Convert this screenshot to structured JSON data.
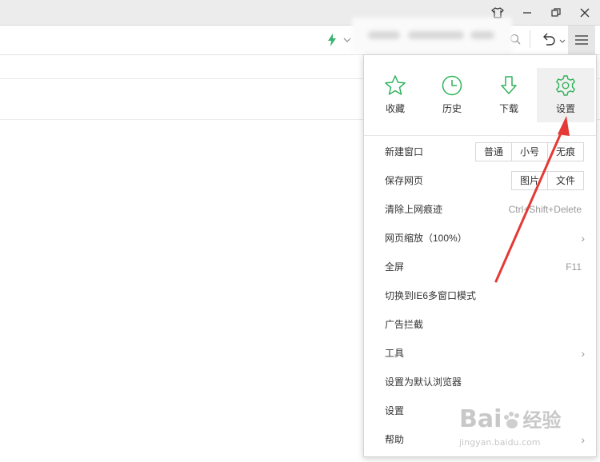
{
  "titlebar": {
    "icons": [
      "shirt-icon",
      "minimize-icon",
      "restore-icon",
      "close-icon"
    ]
  },
  "addressbar": {
    "icons": [
      "lightning-icon",
      "chevron-down-icon",
      "search-icon",
      "undo-icon",
      "menu-icon"
    ],
    "accent": "#3cb371"
  },
  "menu": {
    "quick": [
      {
        "icon": "star-icon",
        "label": "收藏"
      },
      {
        "icon": "clock-icon",
        "label": "历史"
      },
      {
        "icon": "download-icon",
        "label": "下载"
      },
      {
        "icon": "gear-icon",
        "label": "设置"
      }
    ],
    "items": [
      {
        "label": "新建窗口",
        "buttons": [
          "普通",
          "小号",
          "无痕"
        ]
      },
      {
        "label": "保存网页",
        "buttons": [
          "图片",
          "文件"
        ]
      },
      {
        "label": "清除上网痕迹",
        "shortcut": "Ctrl+Shift+Delete"
      },
      {
        "label": "网页缩放（100%）"
      },
      {
        "label": "全屏",
        "shortcut": "F11"
      },
      {
        "label": "切换到IE6多窗口模式"
      },
      {
        "label": "广告拦截"
      },
      {
        "label": "工具"
      },
      {
        "label": "设置为默认浏览器"
      },
      {
        "label": "设置"
      },
      {
        "label": "帮助"
      }
    ]
  },
  "watermark": {
    "brand": "Bai",
    "brand2": "经验",
    "url": "jingyan.baidu.com"
  },
  "colors": {
    "icon_green": "#2fb35a",
    "arrow_red": "#e53935"
  }
}
